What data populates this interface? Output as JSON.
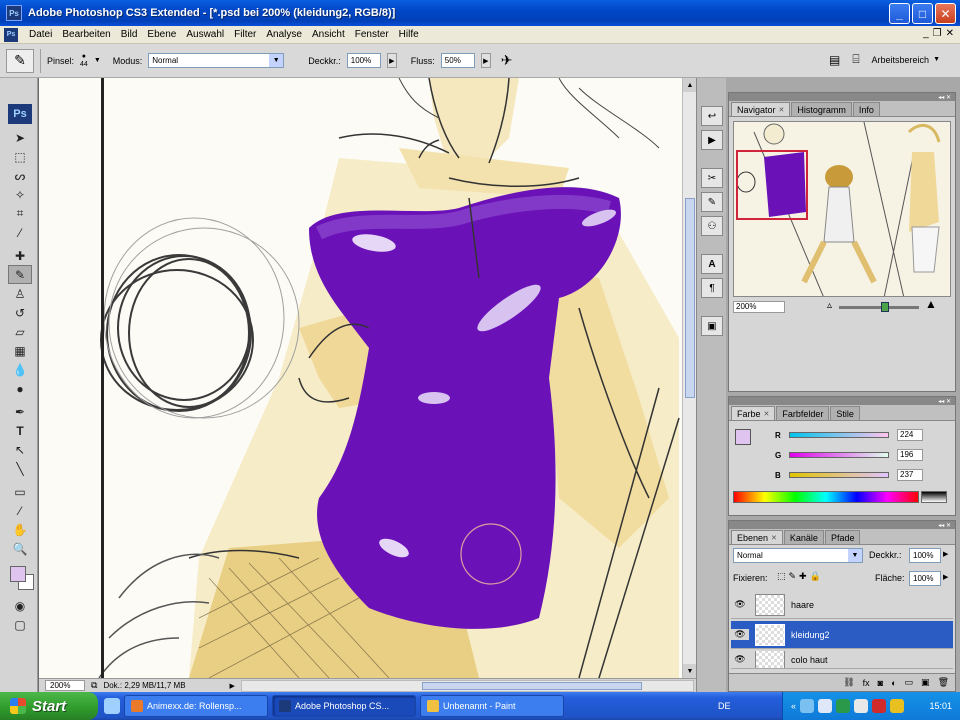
{
  "window": {
    "title": "Adobe Photoshop CS3 Extended - [*.psd bei 200% (kleidung2, RGB/8)]",
    "app_icon": "Ps"
  },
  "menu": [
    "Datei",
    "Bearbeiten",
    "Bild",
    "Ebene",
    "Auswahl",
    "Filter",
    "Analyse",
    "Ansicht",
    "Fenster",
    "Hilfe"
  ],
  "options": {
    "pinsel_label": "Pinsel:",
    "brush_size": "44",
    "modus_label": "Modus:",
    "modus_value": "Normal",
    "deckkraft_label": "Deckkr.:",
    "deckkraft_value": "100%",
    "fluss_label": "Fluss:",
    "fluss_value": "50%",
    "workspace": "Arbeitsbereich"
  },
  "toolbox": {
    "logo": "Ps",
    "foreground_color": "#e0c4f0",
    "background_color": "#ffffff"
  },
  "status": {
    "zoom": "200%",
    "doc_info": "Dok.: 2,29 MB/11,7 MB"
  },
  "navigator": {
    "tabs": [
      "Navigator",
      "Histogramm",
      "Info"
    ],
    "zoom": "200%"
  },
  "color_panel": {
    "tabs": [
      "Farbe",
      "Farbfelder",
      "Stile"
    ],
    "channels": [
      {
        "label": "R",
        "value": "224"
      },
      {
        "label": "G",
        "value": "196"
      },
      {
        "label": "B",
        "value": "237"
      }
    ],
    "swatch": "#e0c4f0"
  },
  "layers_panel": {
    "tabs": [
      "Ebenen",
      "Kanäle",
      "Pfade"
    ],
    "blend_mode": "Normal",
    "deckkraft_label": "Deckkr.:",
    "deckkraft_value": "100%",
    "fixieren_label": "Fixieren:",
    "flaeche_label": "Fläche:",
    "flaeche_value": "100%",
    "layers": [
      {
        "name": "haare",
        "selected": false
      },
      {
        "name": "kleidung2",
        "selected": true
      },
      {
        "name": "colo haut",
        "selected": false
      }
    ]
  },
  "taskbar": {
    "start": "Start",
    "tasks": [
      {
        "label": "Animexx.de: Rollensp...",
        "active": false
      },
      {
        "label": "Adobe Photoshop CS...",
        "active": true
      },
      {
        "label": "Unbenannt - Paint",
        "active": false
      }
    ],
    "language": "DE",
    "clock": "15:01"
  }
}
